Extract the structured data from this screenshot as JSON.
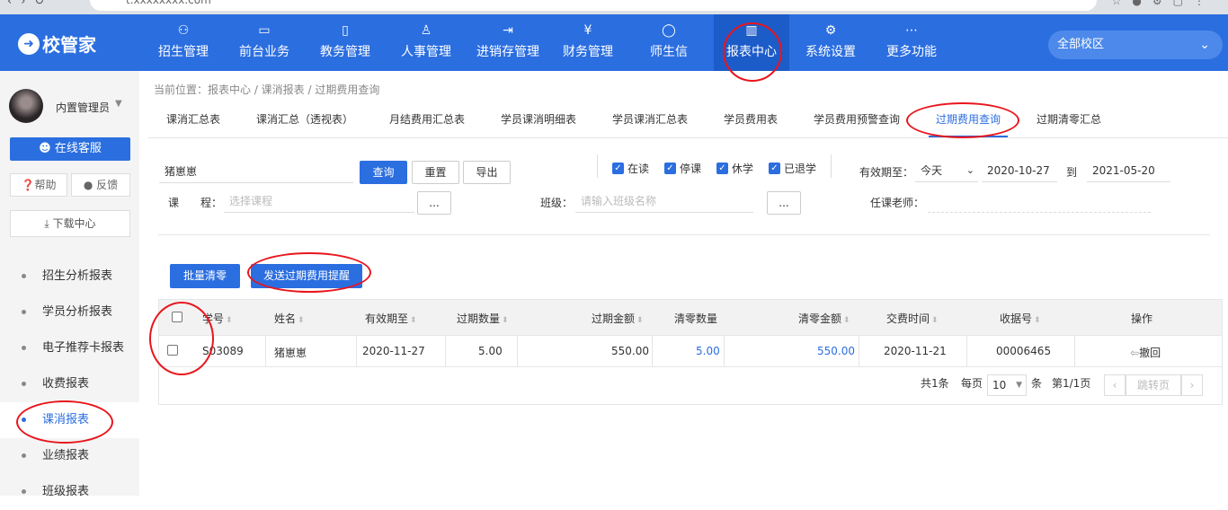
{
  "browser": {
    "url": "t.xxxxxxxx.com"
  },
  "header": {
    "logo": "校管家",
    "nav": [
      {
        "label": "招生管理",
        "icon": "recruit-icon"
      },
      {
        "label": "前台业务",
        "icon": "desk-icon"
      },
      {
        "label": "教务管理",
        "icon": "book-icon"
      },
      {
        "label": "人事管理",
        "icon": "person-icon"
      },
      {
        "label": "进销存管理",
        "icon": "inventory-icon"
      },
      {
        "label": "财务管理",
        "icon": "finance-icon"
      },
      {
        "label": "师生信",
        "icon": "message-icon"
      },
      {
        "label": "报表中心",
        "icon": "chart-icon"
      },
      {
        "label": "系统设置",
        "icon": "gear-icon"
      },
      {
        "label": "更多功能",
        "icon": "more-icon"
      }
    ],
    "campus": "全部校区"
  },
  "sidebar": {
    "user_name": "内置管理员",
    "online_service": "在线客服",
    "help": "帮助",
    "feedback": "反馈",
    "download": "下载中心",
    "items": [
      {
        "label": "招生分析报表"
      },
      {
        "label": "学员分析报表"
      },
      {
        "label": "电子推荐卡报表"
      },
      {
        "label": "收费报表"
      },
      {
        "label": "课消报表"
      },
      {
        "label": "业绩报表"
      },
      {
        "label": "班级报表"
      }
    ]
  },
  "breadcrumb": "当前位置：报表中心 / 课消报表 / 过期费用查询",
  "tabs": [
    "课消汇总表",
    "课消汇总（透视表）",
    "月结费用汇总表",
    "学员课消明细表",
    "学员课消汇总表",
    "学员费用表",
    "学员费用预警查询",
    "过期费用查询",
    "过期清零汇总"
  ],
  "filters": {
    "student_value": "猪崽崽",
    "query": "查询",
    "reset": "重置",
    "export": "导出",
    "statuses": [
      "在读",
      "停课",
      "休学",
      "已退学"
    ],
    "valid_label": "有效期至：",
    "valid_select": "今天",
    "date_from": "2020-10-27",
    "to": "到",
    "date_to": "2021-05-20",
    "course_label": "课　　程：",
    "course_placeholder": "选择课程",
    "ellipsis": "...",
    "class_label": "班级：",
    "class_placeholder": "请输入班级名称",
    "teacher_label": "任课老师："
  },
  "actions": {
    "batch_clear": "批量清零",
    "send_reminder": "发送过期费用提醒"
  },
  "table": {
    "headers": [
      "学号",
      "姓名",
      "有效期至",
      "过期数量",
      "过期金额",
      "清零数量",
      "清零金额",
      "交费时间",
      "收据号",
      "操作"
    ],
    "rows": [
      {
        "id": "S03089",
        "name": "猪崽崽",
        "valid": "2020-11-27",
        "expired_qty": "5.00",
        "expired_amt": "550.00",
        "clear_qty": "5.00",
        "clear_amt": "550.00",
        "pay_time": "2020-11-21",
        "receipt": "00006465",
        "op": "撤回"
      }
    ]
  },
  "pager": {
    "total": "共1条",
    "per_page": "每页",
    "size": "10",
    "unit": "条",
    "page": "第1/1页",
    "jump": "跳转页"
  },
  "colors": {
    "primary": "#2b6ee0",
    "annotation": "#e8161d"
  }
}
